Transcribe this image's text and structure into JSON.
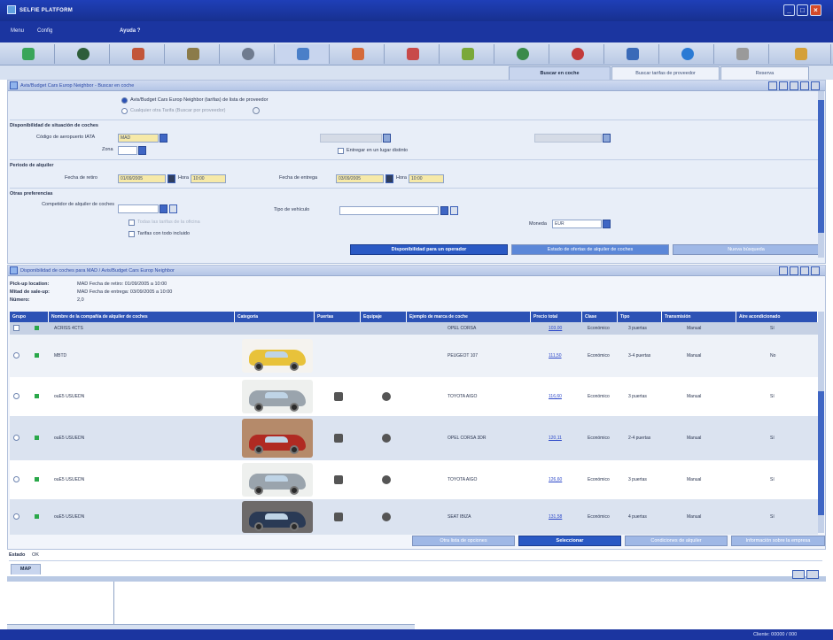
{
  "window": {
    "title": "SELFIE PLATFORM",
    "status_right": "Cliente: 00000 / 000"
  },
  "menu": {
    "items": [
      "Menu",
      "Config",
      "Ayuda ?"
    ]
  },
  "toolbar": {
    "icons": [
      "globe-icon",
      "earth-icon",
      "person-run-icon",
      "building-icon",
      "gear-icon",
      "car-icon",
      "phone-icon",
      "people-icon",
      "tree-icon",
      "world-icon",
      "clock-icon",
      "doc-icon",
      "globe-blue-icon",
      "printer-icon",
      "folder-icon"
    ]
  },
  "tabs": [
    {
      "label": "Buscar en coche",
      "active": true
    },
    {
      "label": "Buscar tarifas de proveedor",
      "active": false
    },
    {
      "label": "Reserva",
      "active": false
    }
  ],
  "search": {
    "header": "Avis/Budget Cars Europ Neighbor - Buscar en coche",
    "radio1": "Avis/Budget Cars Europ Neighbor (tarifas) de lista de proveedor",
    "radio2": "Cualquier otra Tarifa (Buscar por proveedor)",
    "pickup_section": "Disponibilidad de situación de coches",
    "airport_label": "Código de aeropuerto IATA",
    "airport_value": "MAD",
    "zone_label": "Zona",
    "return_elsewhere": "Entregar en un lugar distinto",
    "period_section": "Periodo de alquiler",
    "pickup_date_label": "Fecha de retiro",
    "pickup_date": "01/09/2005",
    "time_label_1": "Hora",
    "time_1": "10:00",
    "return_date_label": "Fecha de entrega",
    "return_date": "03/09/2005",
    "time_label_2": "Hora",
    "time_2": "10:00",
    "prefs_section": "Otras preferencias",
    "supplier_label": "Competidor de alquiler de coches",
    "vehicle_type_label": "Tipo de vehículo",
    "option_text": "Todas las tarifas de la oficina",
    "currency_label": "Moneda",
    "currency_value": "EUR",
    "all_rates_label": "Tarifas con todo incluido",
    "btn_availability": "Disponibilidad para un operador",
    "btn_status": "Estado de ofertas de alquiler de coches",
    "btn_clear": "Nueva búsqueda"
  },
  "results": {
    "header": "Disponibilidad de coches para MAD / Avis/Budget Cars Europ Neighbor",
    "pickup_line_label": "Pick-up location:",
    "pickup_line_value": "MAD Fecha de retiro: 01/09/2005 a 10:00",
    "dropoff_line_label": "Mitad de sale-up:",
    "dropoff_line_value": "MAD Fecha de entrega: 03/09/2005 a 10:00",
    "days_label": "Número:",
    "days_value": "2,0",
    "columns": [
      "Grupo",
      "Nombre de la compañía de alquiler de coches",
      "Categoría",
      "Puertas",
      "Equipaje",
      "Ejemplo de marca de coche",
      "Precio total",
      "Clase",
      "Tipo",
      "Transmisión",
      "Aire acondicionado"
    ],
    "rows": [
      {
        "code": "ACRISS 4CTS",
        "model": "OPEL CORSA",
        "price": "103,00",
        "class": "Económico",
        "type": "3 puertas",
        "trans": "Manual",
        "ac": "Sí"
      },
      {
        "code": "MBTD",
        "model": "PEUGEOT 107",
        "price": "111,50",
        "class": "Económico",
        "type": "3-4 puertas",
        "trans": "Manual",
        "ac": "No"
      },
      {
        "code": "ouE5 USUEDN",
        "model": "TOYOTA AIGO",
        "price": "116,60",
        "class": "Económico",
        "type": "3 puertas",
        "trans": "Manual",
        "ac": "Sí"
      },
      {
        "code": "ouE5 USUEDN",
        "model": "OPEL CORSA 3DR",
        "price": "120,11",
        "class": "Económico",
        "type": "2-4 puertas",
        "trans": "Manual",
        "ac": "Sí"
      },
      {
        "code": "ouE5 USUEDN",
        "model": "TOYOTA AIGO",
        "price": "126,60",
        "class": "Económico",
        "type": "3 puertas",
        "trans": "Manual",
        "ac": "Sí"
      },
      {
        "code": "ouE5 USUEDN",
        "model": "SEAT IBIZA",
        "price": "131,58",
        "class": "Económico",
        "type": "4 puertas",
        "trans": "Manual",
        "ac": "Sí"
      }
    ],
    "btn_1": "Otra lista de opciones",
    "btn_2": "Seleccionar",
    "btn_3": "Condiciones de alquiler",
    "btn_4": "Información sobre la empresa"
  },
  "status": {
    "label": "Estado",
    "value": "OK",
    "tab": "MAP"
  },
  "colors": {
    "accent": "#2c52b5",
    "title_bar": "#1f3fb8",
    "highlight": "#f6e9a8"
  }
}
